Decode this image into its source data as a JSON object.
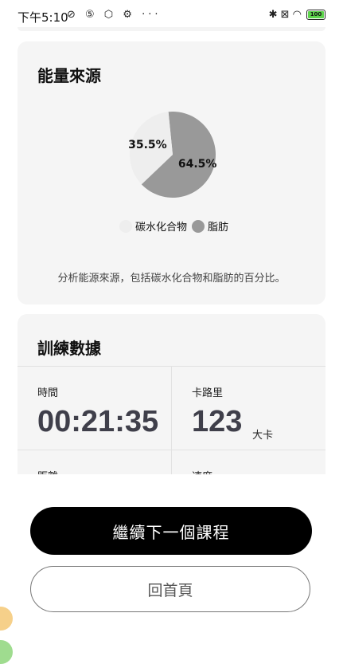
{
  "status_bar": {
    "time": "下午5:10",
    "left_icons": "⊘ ⑤ ⬡ ⚙ ···",
    "right_icons": "✱ ⊠ ◠",
    "battery": "100"
  },
  "energy_card": {
    "title": "能量來源",
    "description": "分析能源來源，包括碳水化合物和脂肪的百分比。"
  },
  "chart_data": {
    "type": "pie",
    "categories": [
      "碳水化合物",
      "脂肪"
    ],
    "values": [
      35.5,
      64.5
    ],
    "labels": [
      "35.5%",
      "64.5%"
    ],
    "colors": [
      "#eeeeee",
      "#999999"
    ],
    "legend": "bottom"
  },
  "training_card": {
    "title": "訓練數據",
    "stats": [
      {
        "label": "時間",
        "value": "00:21:35",
        "unit": ""
      },
      {
        "label": "卡路里",
        "value": "123",
        "unit": "大卡"
      },
      {
        "label": "距離",
        "value": "",
        "unit": ""
      },
      {
        "label": "速度",
        "value": "",
        "unit": ""
      }
    ]
  },
  "actions": {
    "continue_label": "繼續下一個課程",
    "home_label": "回首頁"
  }
}
